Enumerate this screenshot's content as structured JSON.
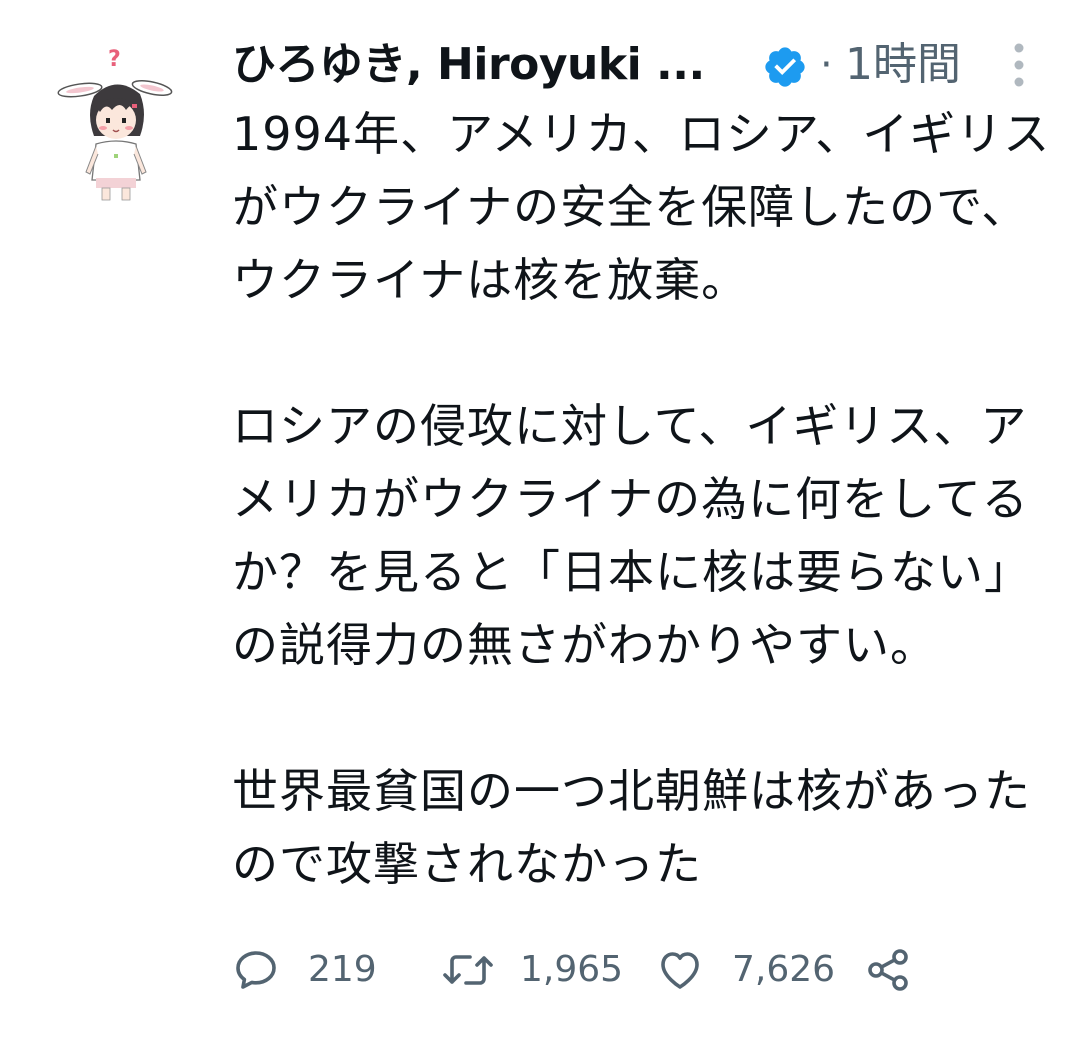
{
  "author": {
    "display_name": "ひろゆき, Hiroyuki ...",
    "verified": true,
    "avatar_icon": "bunny-ear-girl-avatar"
  },
  "meta": {
    "separator": "·",
    "time_ago": "1時間",
    "more_icon": "vertical-dots-icon"
  },
  "tweet": {
    "text": "1994年、アメリカ、ロシア、イギリスがウクライナの安全を保障したので、ウクライナは核を放棄。\n\nロシアの侵攻に対して、イギリス、アメリカがウクライナの為に何をしてるか？を見ると「日本に核は要らない」の説得力の無さがわかりやすい。\n\n世界最貧国の一つ北朝鮮は核があったので攻撃されなかった"
  },
  "actions": {
    "reply_count": "219",
    "retweet_count": "1,965",
    "like_count": "7,626"
  },
  "colors": {
    "text": "#0f1419",
    "secondary": "#536471",
    "verified_blue": "#1d9bf0"
  }
}
